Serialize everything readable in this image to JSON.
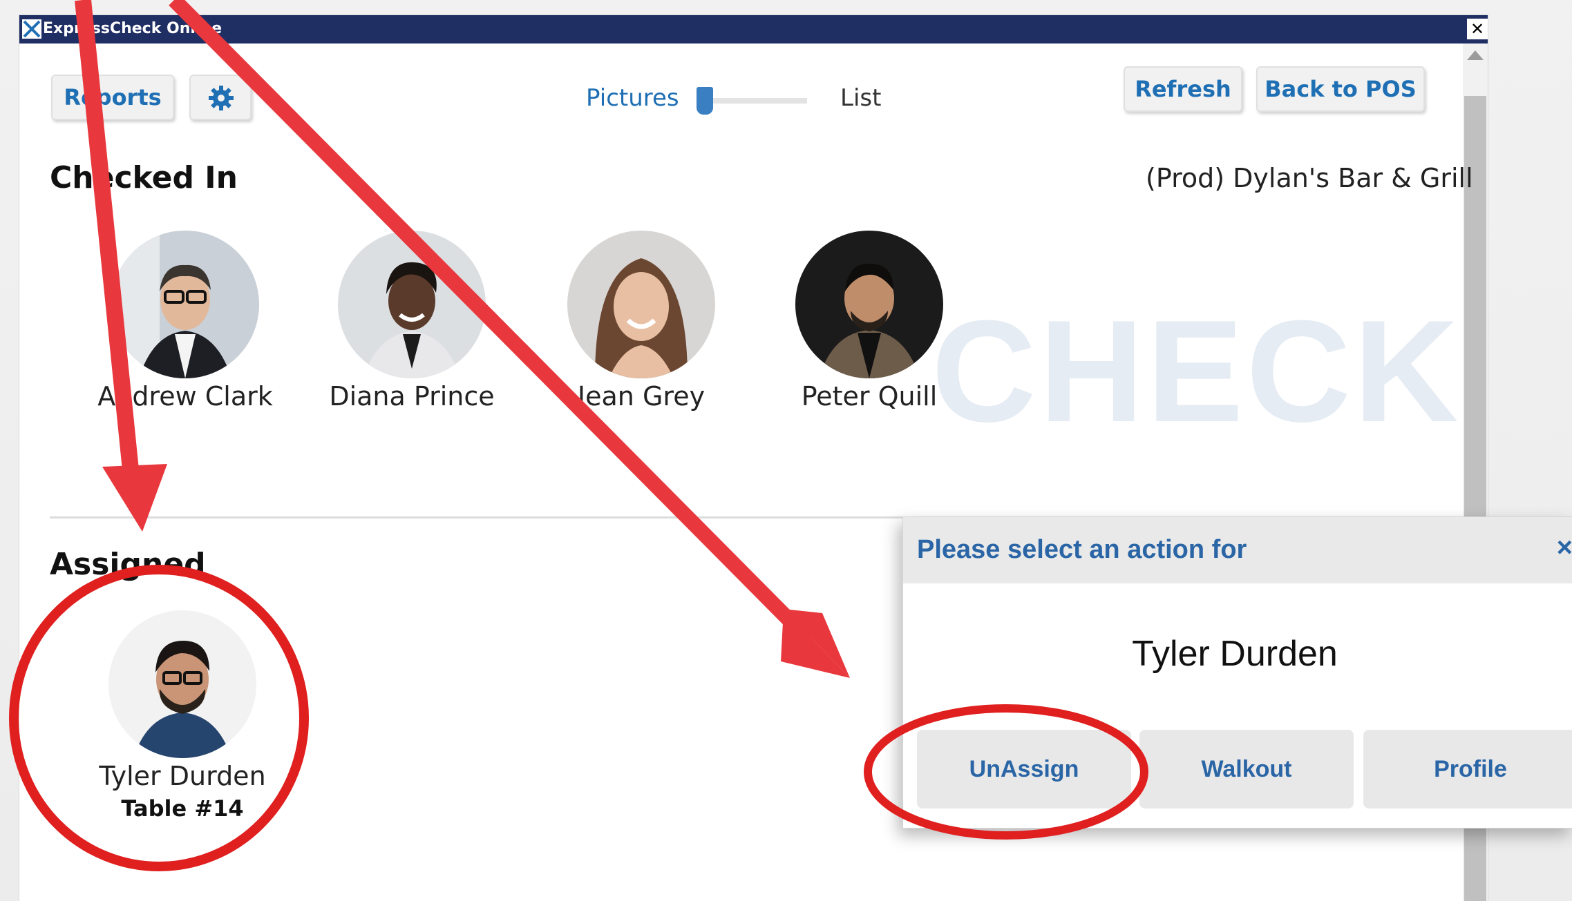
{
  "window": {
    "title": "ExpressCheck Online"
  },
  "toolbar": {
    "reports_label": "Reports",
    "settings_icon": "gear-icon",
    "view_left": "Pictures",
    "view_right": "List",
    "refresh_label": "Refresh",
    "back_label": "Back to POS"
  },
  "checked_in": {
    "title": "Checked In",
    "venue": "(Prod) Dylan's Bar & Grill",
    "watermark": "CHECK",
    "people": [
      {
        "name": "Andrew Clark"
      },
      {
        "name": "Diana Prince"
      },
      {
        "name": "Jean Grey"
      },
      {
        "name": "Peter Quill"
      }
    ]
  },
  "assigned": {
    "title": "Assigned",
    "people": [
      {
        "name": "Tyler Durden",
        "table": "Table #14"
      }
    ]
  },
  "dialog": {
    "header": "Please select an action for",
    "close": "×",
    "name": "Tyler Durden",
    "buttons": {
      "unassign": "UnAssign",
      "walkout": "Walkout",
      "profile": "Profile"
    }
  },
  "colors": {
    "titlebar": "#1f2e63",
    "accent": "#1f6fb4",
    "dialog_accent": "#2a65a6",
    "annotation": "#e8383d"
  }
}
